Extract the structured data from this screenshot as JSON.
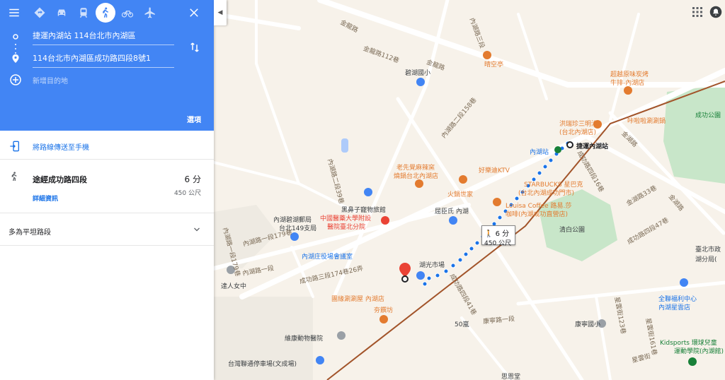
{
  "modes": [
    {
      "name": "directions-best-icon"
    },
    {
      "name": "car-icon"
    },
    {
      "name": "transit-icon"
    },
    {
      "name": "walk-icon"
    },
    {
      "name": "bike-icon"
    },
    {
      "name": "flight-icon"
    }
  ],
  "origin": "捷運內湖站 114台北市內湖區",
  "destination": "114台北市內湖區成功路四段8號1",
  "add_destination": "新增目的地",
  "options_label": "選項",
  "send_to_phone": "將路線傳送至手機",
  "route": {
    "title": "途經成功路四段",
    "time": "6 分",
    "distance": "450 公尺",
    "details_link": "詳細資訊"
  },
  "flat_route": "多為平坦路段",
  "callout": {
    "time": "6 分",
    "distance": "450 公尺"
  },
  "map_labels": {
    "jinlong_road_1": "金龍路",
    "jinlong_road_2": "金龍路",
    "jinlong_lane_112": "金龍路112巷",
    "neihu_lane_3": "內湖路三段",
    "qingkong_ting": "晴空亭",
    "bihu_elementary": "碧湖國小",
    "chaoqi_bbq": "超越原味炭烤",
    "niupai_neihu": "牛排-內湖店",
    "kaladala": "咔啦啦涮涮鍋",
    "chenggong_park": "成功公園",
    "hongruizhen": "洪瑞珍三明治",
    "hongruizhen_branch": "(台北內湖店)",
    "station_label": "內湖站",
    "mrt_station": "捷運內湖站",
    "jinsan_road": "金湖路",
    "neihu_lane_2_158": "內湖路二段158巷",
    "laoxianjue": "老先覺麻辣窯",
    "laoxianjue_branch": "燒鍋台北內湖店",
    "haoledi_ktv": "好樂迪KTV",
    "starbucks": "STARBUCKS 星巴克",
    "starbucks_branch": "(台北內湖成功門市)",
    "heibizi": "黑鼻子寵物旅館",
    "huoguo": "火鍋世家",
    "quchenshi": "屈臣氏 內湖",
    "louisa": "Louisa Coffee 路易.莎",
    "louisa_branch": "咖啡(內湖成功直營店)",
    "qingbai_park": "清白公園",
    "post_office_1": "內湖碧湖郵局",
    "post_office_2": "台北149支局",
    "medical_center": "中國醫藥大學附設",
    "medical_branch": "醫院臺北分院",
    "neihu_lane_1_179": "內湖路一段179巷",
    "neihu_zhuang": "內湖庄役場會議室",
    "hu_guang_market": "湖光市場",
    "neihu_road_1": "內湖路一段",
    "chenggong_lane_174_26": "成功路三段174巷26弄",
    "daren_girls": "達人女中",
    "tuanyuan_hotpot": "團緣涮涮屋 內湖店",
    "ying_ji": "夯饌坊",
    "weikang": "維康動物醫院",
    "wushi_lan": "50嵐",
    "kangning_elementary": "康寧國小",
    "taiwan_parking": "台灣聯通停車場(文成場)",
    "taipei_city_gov": "臺北市政",
    "neihu_branch": "湖分局(",
    "quanlian": "全聯福利中心",
    "quanlian_branch": "內湖星雲店",
    "kidsports": "Kidsports 環球兒童",
    "kidsports_branch": "運動學院(內湖館)",
    "chenggong_road_4_16": "成功路四段16巷",
    "chenggong_road_4_47": "成功路四段47巷",
    "chenggong_road_4_41": "成功路四段41巷",
    "jinhu_road_33": "金湖路33巷",
    "jinhu_road": "金湖路",
    "kangning_road_1": "康寧路一段",
    "xingyun_street": "星雲街",
    "neihu_lane_2_39": "內湖路二段39巷",
    "neihu_road_1_179": "內湖路一段179巷",
    "xingyun_street_123": "星雲街123巷",
    "xingyun_street_161": "星雲街161巷",
    "sisi_tang": "思恩堂"
  },
  "colors": {
    "header_blue": "#4285f4",
    "route_dot": "#1a73e8",
    "mrt_line": "#a2542a",
    "park_green": "#c8e6c9",
    "road_white": "#ffffff",
    "poi_orange": "#e37b2f"
  }
}
